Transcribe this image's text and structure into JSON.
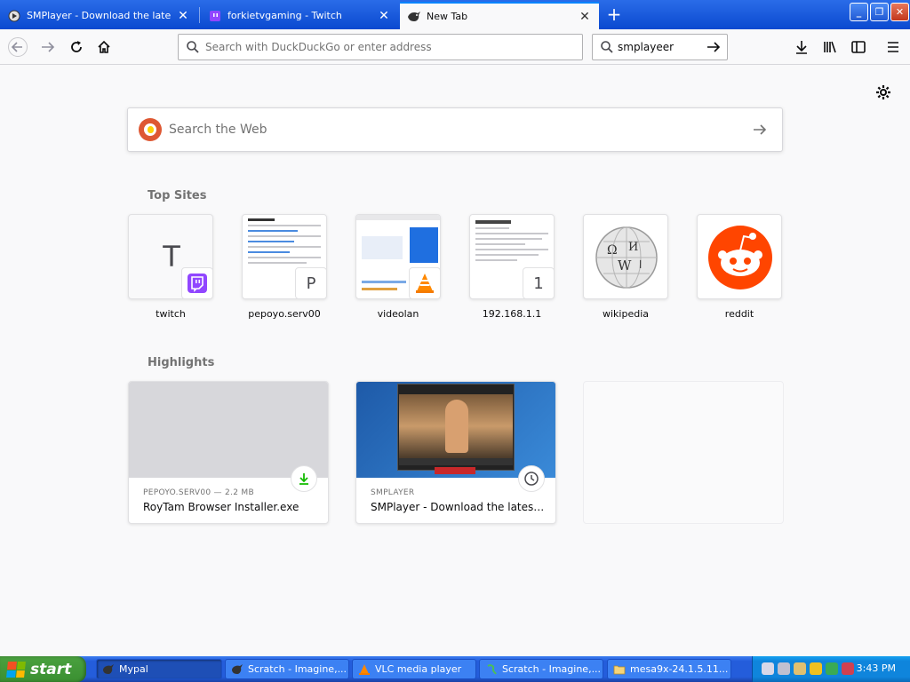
{
  "browser": {
    "tabs": [
      {
        "label": "SMPlayer - Download the latest ve",
        "icon": "smplayer-icon"
      },
      {
        "label": "forkietvgaming - Twitch",
        "icon": "twitch-icon"
      },
      {
        "label": "New Tab",
        "icon": "firefox-icon",
        "active": true
      }
    ],
    "new_tab_label": "+",
    "url_placeholder": "Search with DuckDuckGo or enter address",
    "search_value": "smplayeer"
  },
  "newtab": {
    "search_placeholder": "Search the Web",
    "top_sites_heading": "Top Sites",
    "top_sites": [
      {
        "label": "twitch",
        "letter": "T"
      },
      {
        "label": "pepoyo.serv00",
        "letter": "P"
      },
      {
        "label": "videolan"
      },
      {
        "label": "192.168.1.1",
        "letter": "1"
      },
      {
        "label": "wikipedia"
      },
      {
        "label": "reddit"
      }
    ],
    "highlights_heading": "Highlights",
    "highlights": [
      {
        "context": "PEPOYO.SERV00 — 2.2 MB",
        "title": "RoyTam Browser Installer.exe",
        "badge": "download-icon"
      },
      {
        "context": "SMPLAYER",
        "title": "SMPlayer - Download the latest ...",
        "badge": "clock-icon"
      }
    ]
  },
  "taskbar": {
    "start_label": "start",
    "items": [
      {
        "label": "Mypal",
        "active": true
      },
      {
        "label": "Scratch - Imagine,..."
      },
      {
        "label": "VLC media player"
      },
      {
        "label": "Scratch - Imagine,..."
      },
      {
        "label": "mesa9x-24.1.5.11..."
      }
    ],
    "clock": "3:43 PM"
  },
  "colors": {
    "accent": "#0a84ff",
    "twitch": "#9146ff",
    "reddit": "#ff4500",
    "ddg": "#de5833",
    "download_green": "#12bc00"
  }
}
